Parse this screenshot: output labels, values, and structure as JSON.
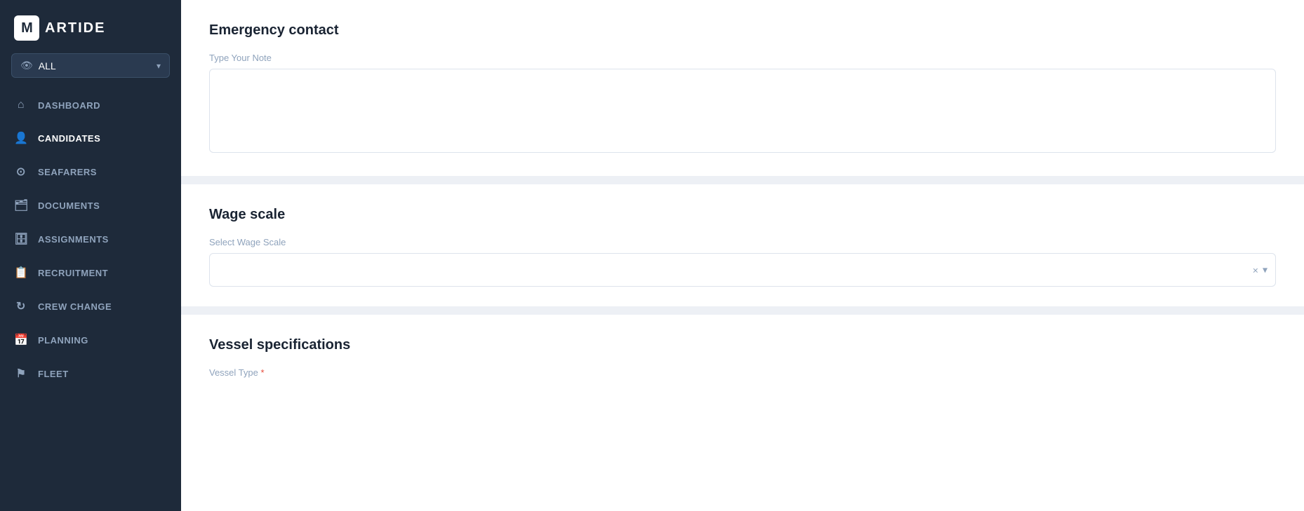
{
  "sidebar": {
    "logo": {
      "letter": "M",
      "name": "ARTIDE"
    },
    "filter": {
      "label": "ALL",
      "icon": "👁"
    },
    "nav_items": [
      {
        "id": "dashboard",
        "label": "DASHBOARD",
        "icon": "⌂"
      },
      {
        "id": "candidates",
        "label": "CANDIDATES",
        "icon": "👤"
      },
      {
        "id": "seafarers",
        "label": "SEAFARERS",
        "icon": "⊙"
      },
      {
        "id": "documents",
        "label": "DOCUMENTS",
        "icon": "🗂"
      },
      {
        "id": "assignments",
        "label": "ASSIGNMENTS",
        "icon": "🗄"
      },
      {
        "id": "recruitment",
        "label": "RECRUITMENT",
        "icon": "📋"
      },
      {
        "id": "crew-change",
        "label": "CREW CHANGE",
        "icon": "↻"
      },
      {
        "id": "planning",
        "label": "PLANNING",
        "icon": "📅"
      },
      {
        "id": "fleet",
        "label": "FLEET",
        "icon": "⚑"
      }
    ]
  },
  "main": {
    "sections": [
      {
        "id": "emergency-contact",
        "title": "Emergency contact",
        "field_label": "Type Your Note",
        "textarea_placeholder": ""
      },
      {
        "id": "wage-scale",
        "title": "Wage scale",
        "field_label": "Select Wage Scale",
        "select_placeholder": ""
      },
      {
        "id": "vessel-specifications",
        "title": "Vessel specifications",
        "field_label": "Vessel Type",
        "field_required": true
      }
    ]
  },
  "icons": {
    "eye": "👁",
    "chevron_down": "▾",
    "clear": "×",
    "expand": "▾"
  }
}
